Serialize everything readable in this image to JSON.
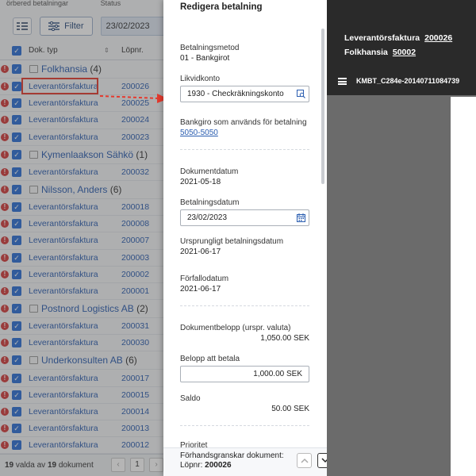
{
  "background": {
    "top_tabs": [
      "örbered betalningar",
      "Status"
    ],
    "toolbar": {
      "filter_label": "Filter",
      "date_value": "23/02/2023"
    },
    "columns": {
      "doc_type": "Dok. typ",
      "lopnr": "Löpnr."
    },
    "rows": [
      {
        "kind": "group",
        "name": "Folkhansia",
        "count": "(4)"
      },
      {
        "kind": "item",
        "doc_type": "Leverantörsfaktura",
        "lopnr": "200026",
        "highlighted": true
      },
      {
        "kind": "item",
        "doc_type": "Leverantörsfaktura",
        "lopnr": "200025"
      },
      {
        "kind": "item",
        "doc_type": "Leverantörsfaktura",
        "lopnr": "200024"
      },
      {
        "kind": "item",
        "doc_type": "Leverantörsfaktura",
        "lopnr": "200023"
      },
      {
        "kind": "group",
        "name": "Kymenlaakson Sähkö",
        "count": "(1)"
      },
      {
        "kind": "item",
        "doc_type": "Leverantörsfaktura",
        "lopnr": "200032"
      },
      {
        "kind": "group",
        "name": "Nilsson, Anders",
        "count": "(6)"
      },
      {
        "kind": "item",
        "doc_type": "Leverantörsfaktura",
        "lopnr": "200018"
      },
      {
        "kind": "item",
        "doc_type": "Leverantörsfaktura",
        "lopnr": "200008"
      },
      {
        "kind": "item",
        "doc_type": "Leverantörsfaktura",
        "lopnr": "200007"
      },
      {
        "kind": "item",
        "doc_type": "Leverantörsfaktura",
        "lopnr": "200003"
      },
      {
        "kind": "item",
        "doc_type": "Leverantörsfaktura",
        "lopnr": "200002"
      },
      {
        "kind": "item",
        "doc_type": "Leverantörsfaktura",
        "lopnr": "200001"
      },
      {
        "kind": "group",
        "name": "Postnord Logistics AB",
        "count": "(2)"
      },
      {
        "kind": "item",
        "doc_type": "Leverantörsfaktura",
        "lopnr": "200031"
      },
      {
        "kind": "item",
        "doc_type": "Leverantörsfaktura",
        "lopnr": "200030"
      },
      {
        "kind": "group",
        "name": "Underkonsulten AB",
        "count": "(6)"
      },
      {
        "kind": "item",
        "doc_type": "Leverantörsfaktura",
        "lopnr": "200017"
      },
      {
        "kind": "item",
        "doc_type": "Leverantörsfaktura",
        "lopnr": "200015"
      },
      {
        "kind": "item",
        "doc_type": "Leverantörsfaktura",
        "lopnr": "200014"
      },
      {
        "kind": "item",
        "doc_type": "Leverantörsfaktura",
        "lopnr": "200013"
      },
      {
        "kind": "item",
        "doc_type": "Leverantörsfaktura",
        "lopnr": "200012"
      }
    ],
    "footer": {
      "selected": "19",
      "mid": " valda av ",
      "total": "19",
      "suffix": " dokument",
      "page": "1"
    }
  },
  "panel": {
    "title": "Redigera betalning",
    "betalningsmetod_label": "Betalningsmetod",
    "betalningsmetod_value": "01 - Bankgirot",
    "likvidkonto_label": "Likvidkonto",
    "likvidkonto_value": "1930 - Checkräkningskonto",
    "bankgiro_label": "Bankgiro som används för betalning",
    "bankgiro_value": "5050-5050",
    "dokumentdatum_label": "Dokumentdatum",
    "dokumentdatum_value": "2021-05-18",
    "betalningsdatum_label": "Betalningsdatum",
    "betalningsdatum_value": "23/02/2023",
    "urspr_label": "Ursprungligt betalningsdatum",
    "urspr_value": "2021-06-17",
    "forfallo_label": "Förfallodatum",
    "forfallo_value": "2021-06-17",
    "dokbelopp_label": "Dokumentbelopp (urspr. valuta)",
    "dokbelopp_value": "1,050.00 SEK",
    "belopp_label": "Belopp att betala",
    "belopp_value": "1,000.00 SEK",
    "saldo_label": "Saldo",
    "saldo_value": "50.00 SEK",
    "prioritet_label": "Prioritet",
    "footer_line1": "Förhandsgranskar dokument:",
    "footer_lopnr_label": "Löpnr: ",
    "footer_lopnr_value": "200026"
  },
  "viewer": {
    "line1_label": "Leverantörsfaktura",
    "line1_value": "200026",
    "line2_label": "Folkhansia",
    "line2_value": "50002",
    "file_name": "KMBT_C284e-20140711084739"
  },
  "colors": {
    "accent": "#2b6fd6",
    "link": "#2a5db0",
    "error": "#d23a3a",
    "highlight": "#e53a2e",
    "viewer_head": "#2a2a2a"
  }
}
